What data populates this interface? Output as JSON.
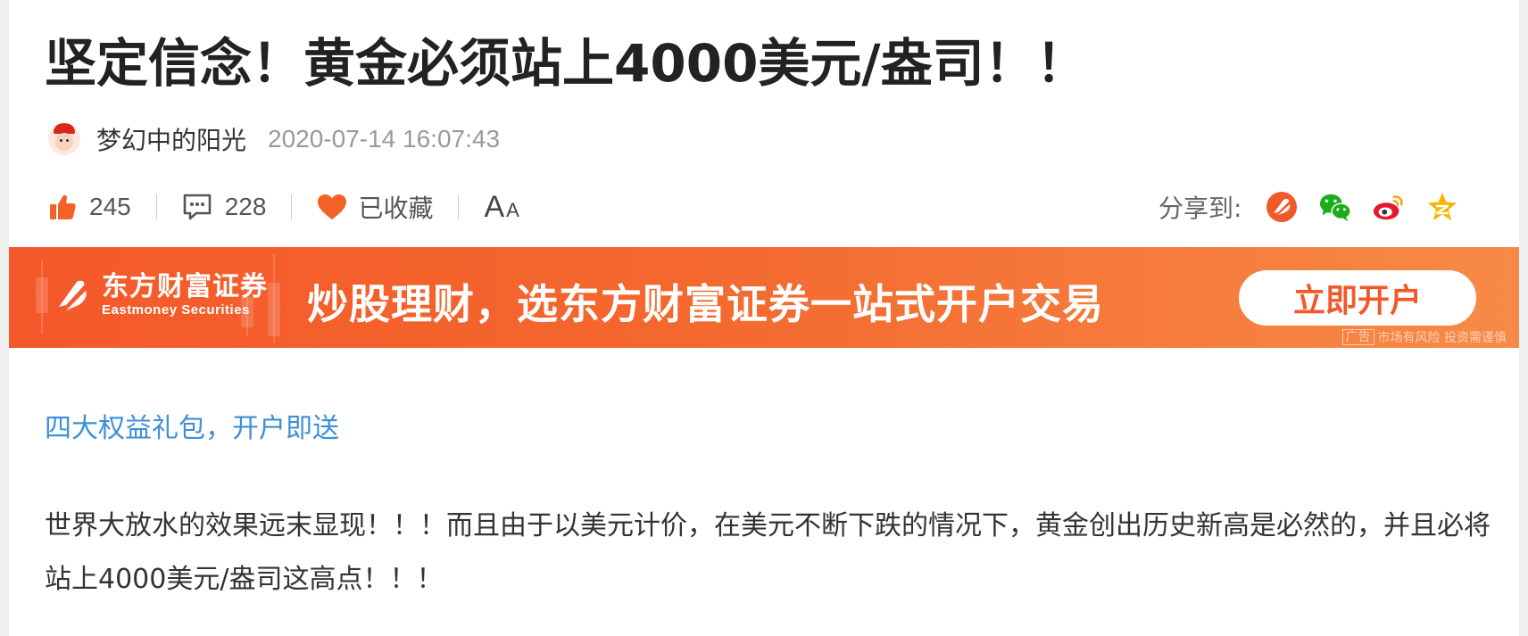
{
  "article": {
    "title": "坚定信念！黄金必须站上4000美元/盎司！！",
    "author": "梦幻中的阳光",
    "time": "2020-07-14 16:07:43"
  },
  "actions": {
    "likes": "245",
    "comments": "228",
    "favorite_label": "已收藏",
    "font_size_big": "A",
    "font_size_small": "A"
  },
  "share": {
    "label": "分享到:",
    "targets": [
      "eastmoney-share-icon",
      "wechat-icon",
      "weibo-icon",
      "qzone-icon"
    ]
  },
  "banner": {
    "brand_cn": "东方财富证券",
    "brand_en": "Eastmoney Securities",
    "slogan": "炒股理财，选东方财富证券一站式开户交易",
    "cta": "立即开户",
    "ad_tag": "广告",
    "disclaimer": "市场有风险 投资需谨慎"
  },
  "content": {
    "promo_link": "四大权益礼包，开户即送",
    "paragraph": "世界大放水的效果远末显现！！！而且由于以美元计价，在美元不断下跌的情况下，黄金创出历史新高是必然的，并且必将站上4000美元/盎司这高点！！！"
  },
  "colors": {
    "accent_orange": "#f05a2b",
    "link_blue": "#3d8fd8",
    "wechat_green": "#1aad19",
    "weibo_red": "#e6162d",
    "qzone_yellow": "#f7b500"
  }
}
